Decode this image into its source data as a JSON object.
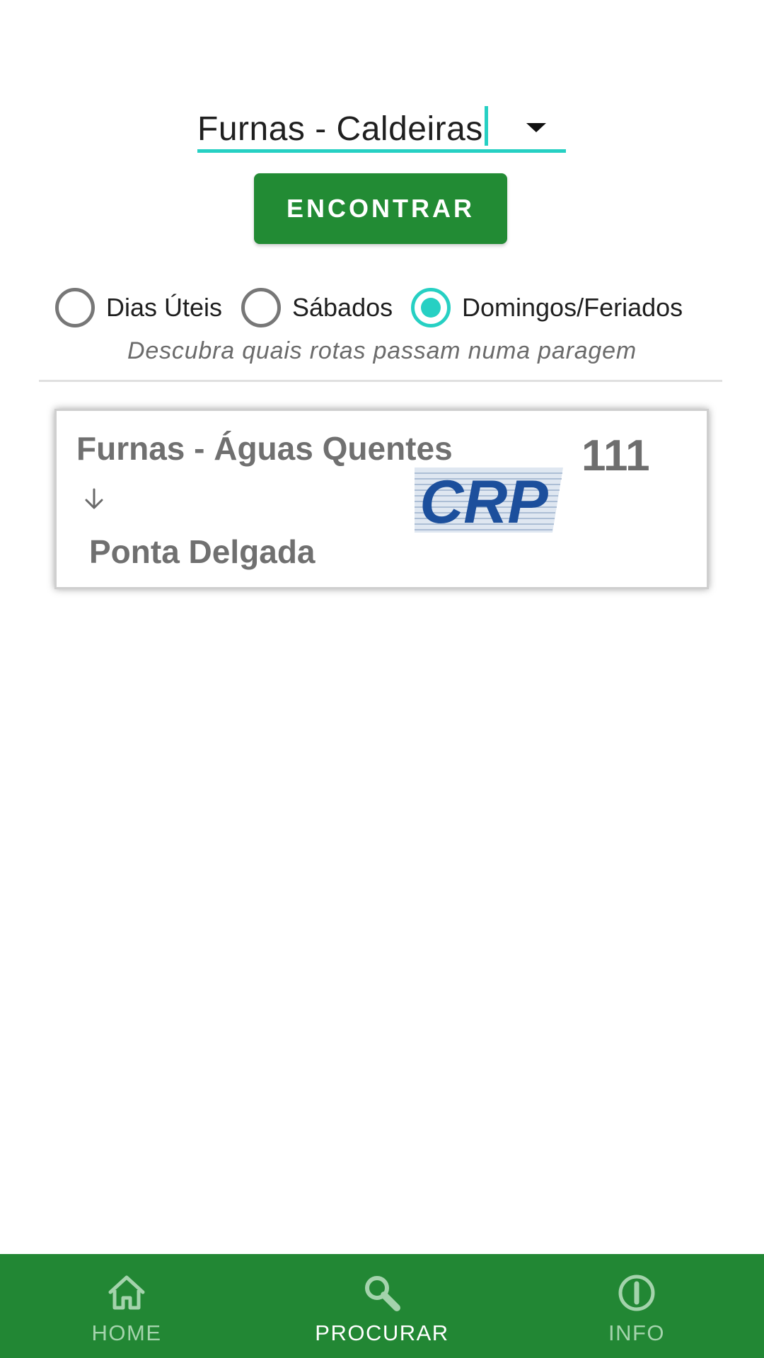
{
  "stop_selector": {
    "value": "Furnas - Caldeiras"
  },
  "find_button": {
    "label": "ENCONTRAR"
  },
  "day_type": {
    "options": [
      {
        "label": "Dias Úteis",
        "checked": false
      },
      {
        "label": "Sábados",
        "checked": false
      },
      {
        "label": "Domingos/Feriados",
        "checked": true
      }
    ]
  },
  "hint": "Descubra quais rotas passam numa paragem",
  "routes": [
    {
      "origin": "Furnas - Águas Quentes",
      "destination": "Ponta Delgada",
      "number": "111",
      "operator_logo_text": "CRP"
    }
  ],
  "bottom_nav": {
    "items": [
      {
        "label": "HOME",
        "icon": "home-icon",
        "active": false
      },
      {
        "label": "PROCURAR",
        "icon": "search-icon",
        "active": true
      },
      {
        "label": "INFO",
        "icon": "info-icon",
        "active": false
      }
    ]
  },
  "colors": {
    "primary_green": "#228b34",
    "accent_teal": "#26d0c3",
    "nav_inactive": "#a4d3ac"
  }
}
